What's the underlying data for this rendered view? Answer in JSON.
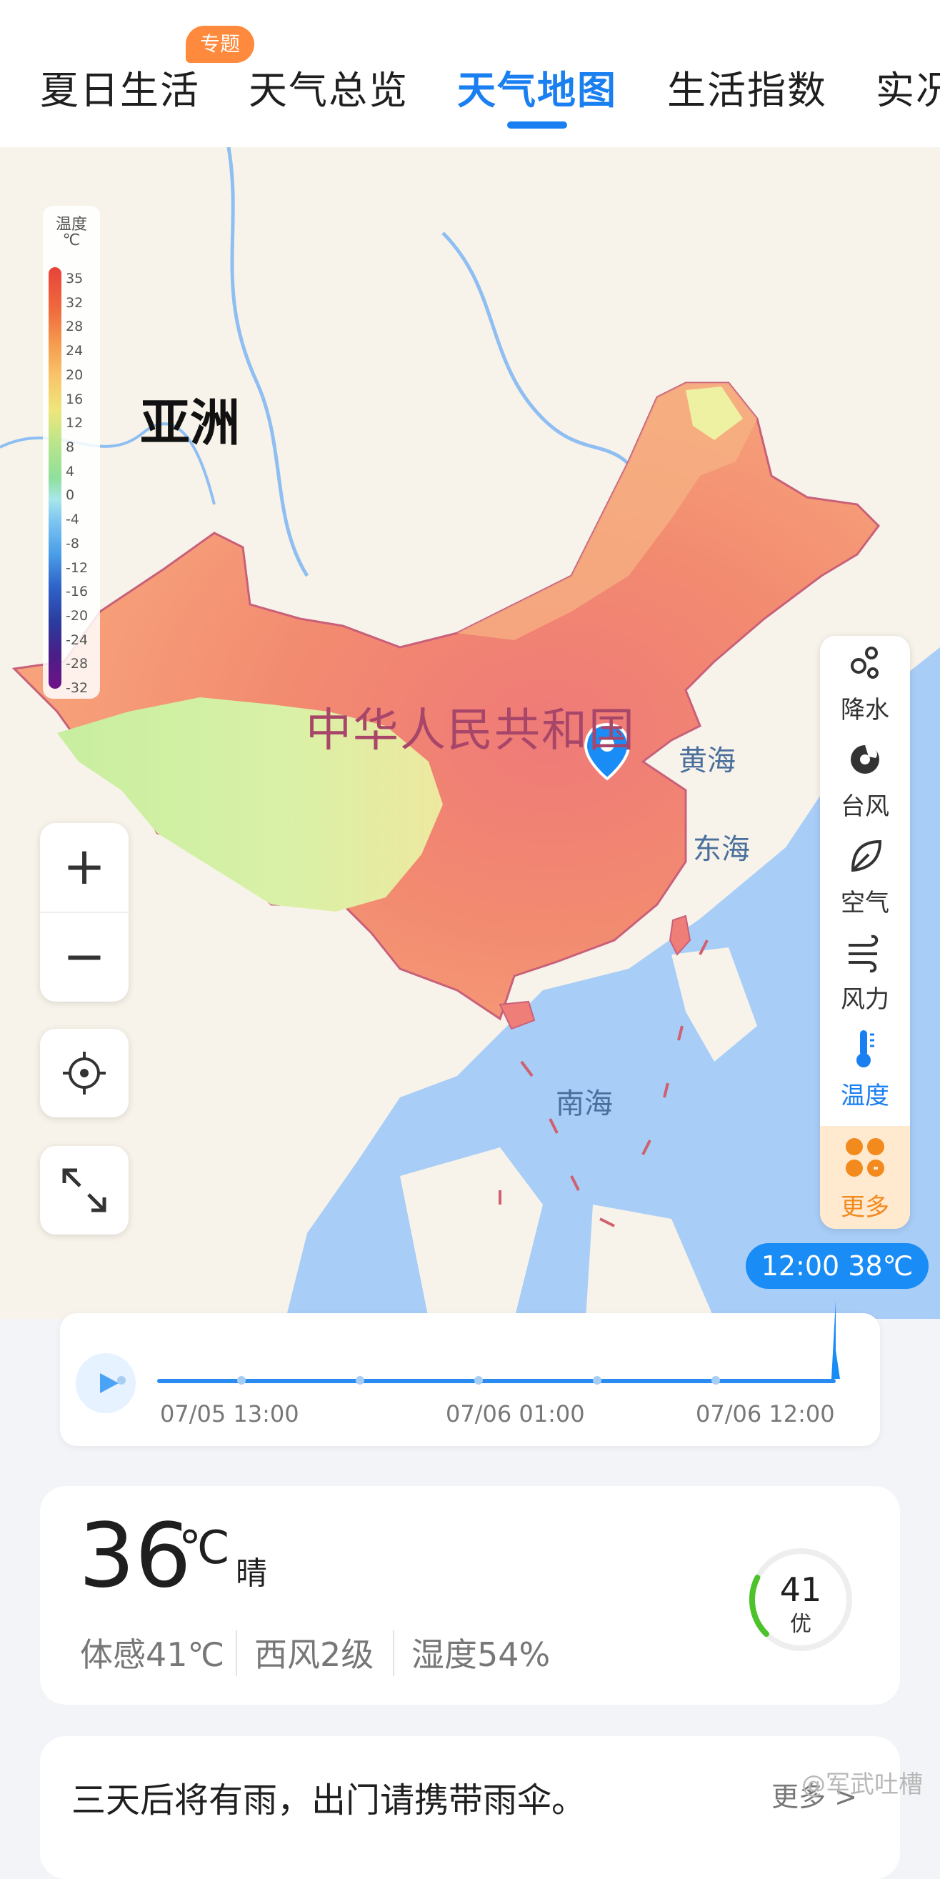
{
  "tabs": [
    {
      "label": "夏日生活",
      "badge": "专题",
      "active": false
    },
    {
      "label": "天气总览",
      "active": false
    },
    {
      "label": "天气地图",
      "active": true
    },
    {
      "label": "生活指数",
      "active": false
    },
    {
      "label": "实况",
      "active": false
    }
  ],
  "map": {
    "continent_label": "亚洲",
    "country_label": "中华人民共和国",
    "seas": [
      "黄海",
      "东海",
      "南海"
    ],
    "legend": {
      "title": "温度",
      "unit": "℃",
      "ticks": [
        "35",
        "32",
        "28",
        "24",
        "20",
        "16",
        "12",
        "8",
        "4",
        "0",
        "-4",
        "-8",
        "-12",
        "-16",
        "-20",
        "-24",
        "-28",
        "-32"
      ]
    },
    "zoom_in": "+",
    "zoom_out": "−"
  },
  "layers": [
    {
      "label": "降水",
      "icon": "precipitation-icon",
      "active": false
    },
    {
      "label": "台风",
      "icon": "typhoon-icon",
      "active": false
    },
    {
      "label": "空气",
      "icon": "air-leaf-icon",
      "active": false
    },
    {
      "label": "风力",
      "icon": "wind-icon",
      "active": false
    },
    {
      "label": "温度",
      "icon": "thermometer-icon",
      "active": true
    },
    {
      "label": "更多",
      "icon": "more-grid-icon",
      "active": false
    }
  ],
  "time_badge": "12:00 38℃",
  "timeline": {
    "labels": [
      "07/05 13:00",
      "07/06 01:00",
      "07/06 12:00"
    ],
    "progress": 1.0
  },
  "weather": {
    "temp": "36",
    "unit": "℃",
    "condition": "晴",
    "feels_like": "体感41℃",
    "wind": "西风2级",
    "humidity": "湿度54%",
    "aqi": "41",
    "aqi_level": "优",
    "aqi_fraction": 0.2
  },
  "notice": {
    "text": "三天后将有雨，出门请携带雨伞。",
    "more": "更多 >"
  },
  "watermark": "@军武吐槽",
  "colors": {
    "accent": "#1a7ff0",
    "badge": "#ff8a3d",
    "more": "#f28a1e",
    "aqi_good": "#4cc22b",
    "ocean": "#a8cdf7"
  }
}
